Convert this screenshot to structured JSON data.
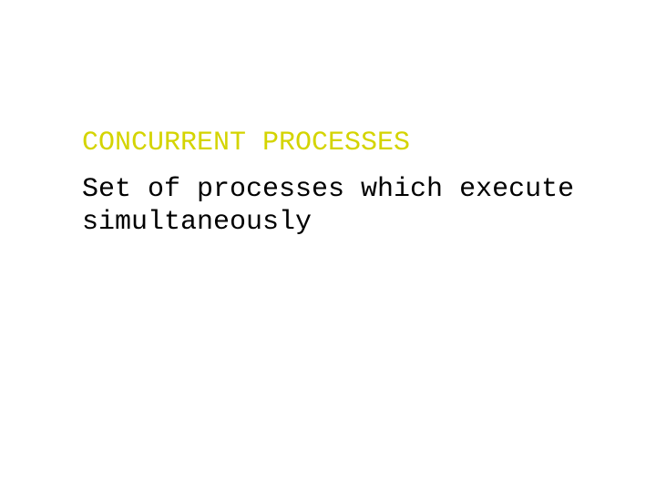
{
  "slide": {
    "title": "CONCURRENT PROCESSES",
    "body": "Set of processes which execute simultaneously"
  }
}
